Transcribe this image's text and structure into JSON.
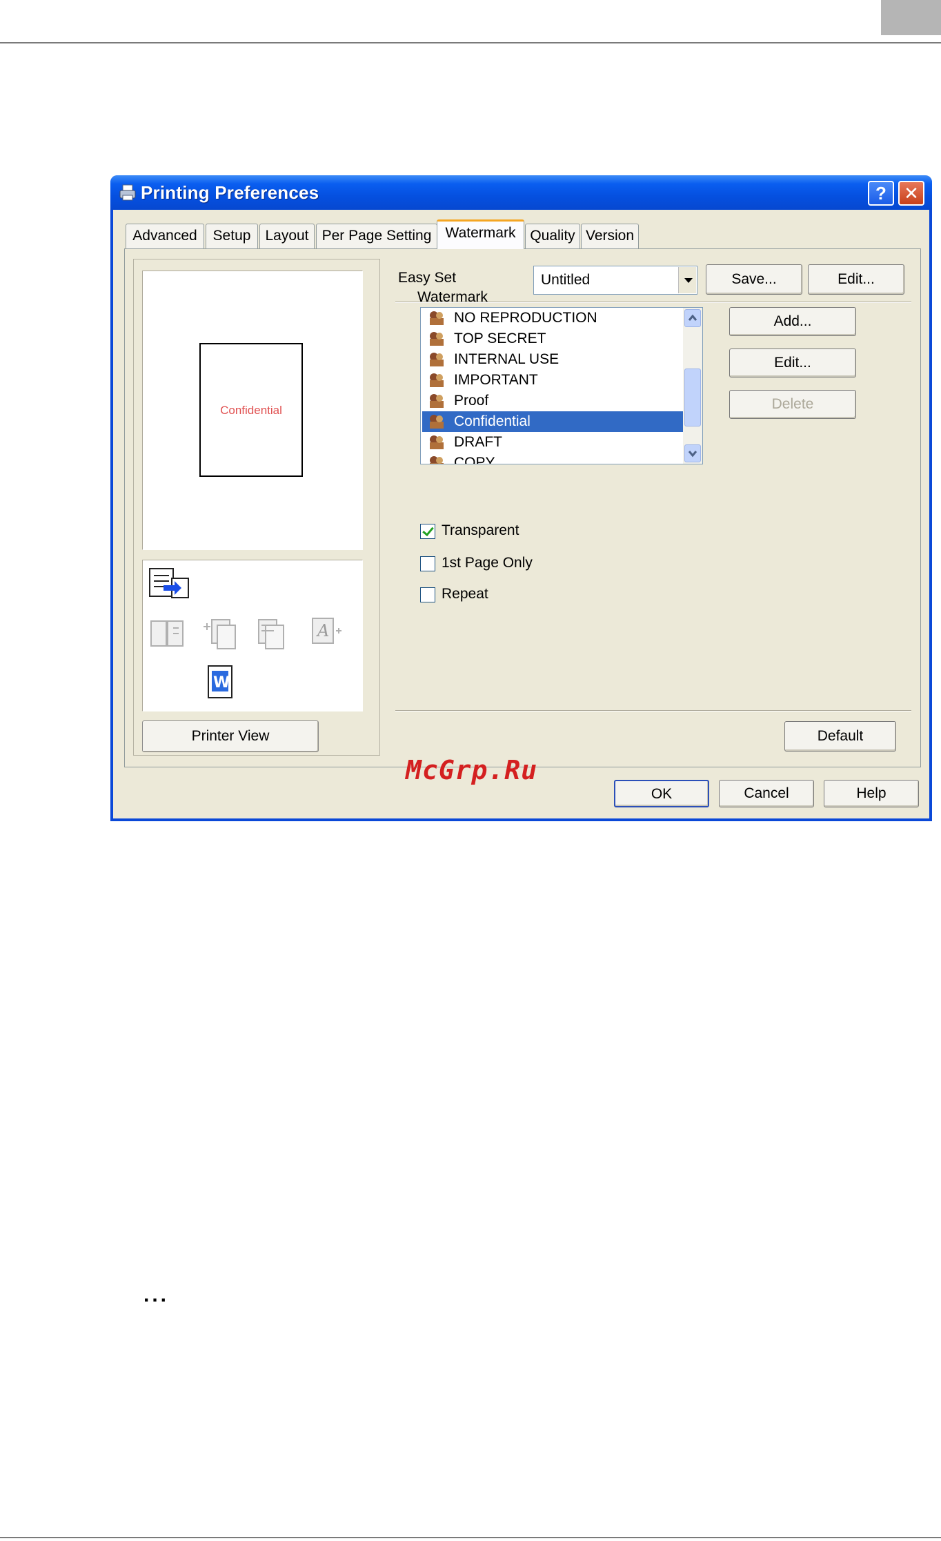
{
  "window": {
    "title": "Printing Preferences",
    "help_button": "?",
    "close_button": "✕"
  },
  "tabs": [
    {
      "label": "Advanced"
    },
    {
      "label": "Setup"
    },
    {
      "label": "Layout"
    },
    {
      "label": "Per Page Setting"
    },
    {
      "label": "Watermark",
      "active": true
    },
    {
      "label": "Quality"
    },
    {
      "label": "Version"
    }
  ],
  "preview": {
    "page_watermark_text": "Confidential",
    "printer_view_button": "Printer View"
  },
  "easy_set": {
    "label": "Easy Set",
    "selected": "Untitled",
    "save_button": "Save...",
    "edit_button": "Edit..."
  },
  "watermark": {
    "group_label": "Watermark",
    "items": [
      {
        "label": "NO REPRODUCTION",
        "selected": false
      },
      {
        "label": "TOP SECRET",
        "selected": false
      },
      {
        "label": "INTERNAL USE",
        "selected": false
      },
      {
        "label": "IMPORTANT",
        "selected": false
      },
      {
        "label": "Proof",
        "selected": false
      },
      {
        "label": "Confidential",
        "selected": true
      },
      {
        "label": "DRAFT",
        "selected": false
      },
      {
        "label": "COPY",
        "selected": false
      }
    ],
    "add_button": "Add...",
    "edit_button": "Edit...",
    "delete_button": "Delete"
  },
  "options": {
    "transparent": {
      "label": "Transparent",
      "checked": true
    },
    "first_page_only": {
      "label": "1st Page Only",
      "checked": false
    },
    "repeat": {
      "label": "Repeat",
      "checked": false
    }
  },
  "buttons": {
    "default": "Default",
    "ok": "OK",
    "cancel": "Cancel",
    "help": "Help"
  },
  "page": {
    "watermark_logo": "McGrp.Ru",
    "ellipsis": "..."
  },
  "colors": {
    "titlebar": "#0a5ef0",
    "selection": "#316ac5",
    "logo_red": "#d42020"
  }
}
